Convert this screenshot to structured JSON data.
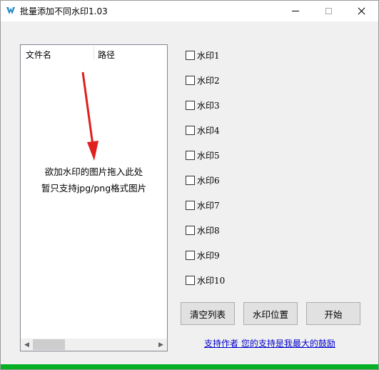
{
  "window": {
    "title": "批量添加不同水印1.03"
  },
  "file_list": {
    "columns": [
      "文件名",
      "路径"
    ],
    "drop_hint_line1": "欲加水印的图片拖入此处",
    "drop_hint_line2": "暂只支持jpg/png格式图片"
  },
  "watermarks": [
    {
      "label": "水印1",
      "checked": false
    },
    {
      "label": "水印2",
      "checked": false
    },
    {
      "label": "水印3",
      "checked": false
    },
    {
      "label": "水印4",
      "checked": false
    },
    {
      "label": "水印5",
      "checked": false
    },
    {
      "label": "水印6",
      "checked": false
    },
    {
      "label": "水印7",
      "checked": false
    },
    {
      "label": "水印8",
      "checked": false
    },
    {
      "label": "水印9",
      "checked": false
    },
    {
      "label": "水印10",
      "checked": false
    }
  ],
  "buttons": {
    "clear_list": "清空列表",
    "watermark_position": "水印位置",
    "start": "开始"
  },
  "support_link": "支持作者  您的支持是我最大的鼓励",
  "progress": {
    "value": 1.0
  },
  "colors": {
    "progress": "#06b025",
    "arrow": "#e0201c",
    "link": "#0000cc"
  }
}
